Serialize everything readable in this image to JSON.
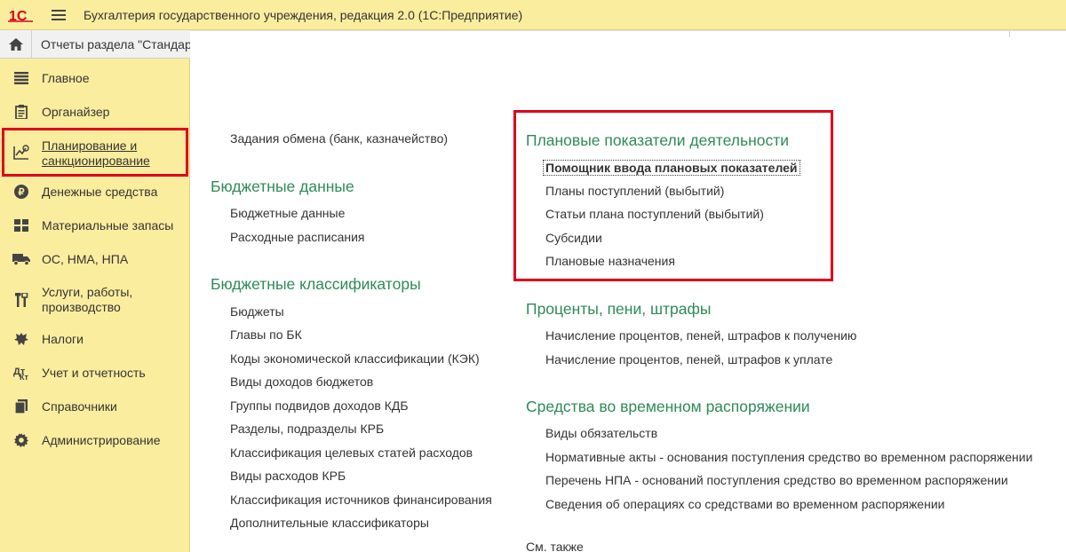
{
  "window": {
    "logo_text": "1С",
    "title": "Бухгалтерия государственного учреждения, редакция 2.0  (1С:Предприятие)"
  },
  "tab": {
    "label": "Отчеты раздела \"Стандар"
  },
  "sidebar": {
    "items": [
      {
        "label": "Главное",
        "icon": "list-icon"
      },
      {
        "label": "Органайзер",
        "icon": "clipboard-icon"
      },
      {
        "label": "Планирование и санкционирование",
        "icon": "planning-icon"
      },
      {
        "label": "Денежные средства",
        "icon": "coin-icon"
      },
      {
        "label": "Материальные запасы",
        "icon": "grid-icon"
      },
      {
        "label": "ОС, НМА, НПА",
        "icon": "truck-icon"
      },
      {
        "label": "Услуги, работы, производство",
        "icon": "tools-icon"
      },
      {
        "label": "Налоги",
        "icon": "emblem-icon"
      },
      {
        "label": "Учет и отчетность",
        "icon": "accounting-icon"
      },
      {
        "label": "Справочники",
        "icon": "books-icon"
      },
      {
        "label": "Администрирование",
        "icon": "gear-icon"
      }
    ],
    "active_index": 2
  },
  "left_column": {
    "top_link": "Задания обмена (банк, казначейство)",
    "budget_data": {
      "title": "Бюджетные данные",
      "links": [
        "Бюджетные данные",
        "Расходные расписания"
      ]
    },
    "budget_classifiers": {
      "title": "Бюджетные классификаторы",
      "links": [
        "Бюджеты",
        "Главы по БК",
        "Коды экономической классификации (КЭК)",
        "Виды доходов бюджетов",
        "Группы подвидов доходов КДБ",
        "Разделы, подразделы КРБ",
        "Классификация целевых статей расходов",
        "Виды расходов КРБ",
        "Классификация источников финансирования",
        "Дополнительные классификаторы"
      ]
    }
  },
  "right_column": {
    "plan_indicators": {
      "title": "Плановые показатели деятельности",
      "links": [
        "Помощник ввода плановых показателей",
        "Планы поступлений (выбытий)",
        "Статьи плана поступлений (выбытий)",
        "Субсидии",
        "Плановые назначения"
      ],
      "focused_index": 0
    },
    "penalties": {
      "title": "Проценты, пени, штрафы",
      "links": [
        "Начисление процентов, пеней, штрафов к получению",
        "Начисление процентов, пеней, штрафов к уплате"
      ]
    },
    "temp_funds": {
      "title": "Средства во временном распоряжении",
      "links": [
        "Виды обязательств",
        "Нормативные акты - основания  поступления средство во временном распоряжении",
        "Перечень НПА - оснований поступления средство во временном распоряжении",
        "Сведения об операциях со средствами во временном распоряжении"
      ]
    },
    "see_also": "См. также"
  },
  "colors": {
    "sidebar_bg": "#fbed9e",
    "section_green": "#2e8b57",
    "highlight_red": "#e0001b",
    "logo_red": "#d6001c"
  }
}
